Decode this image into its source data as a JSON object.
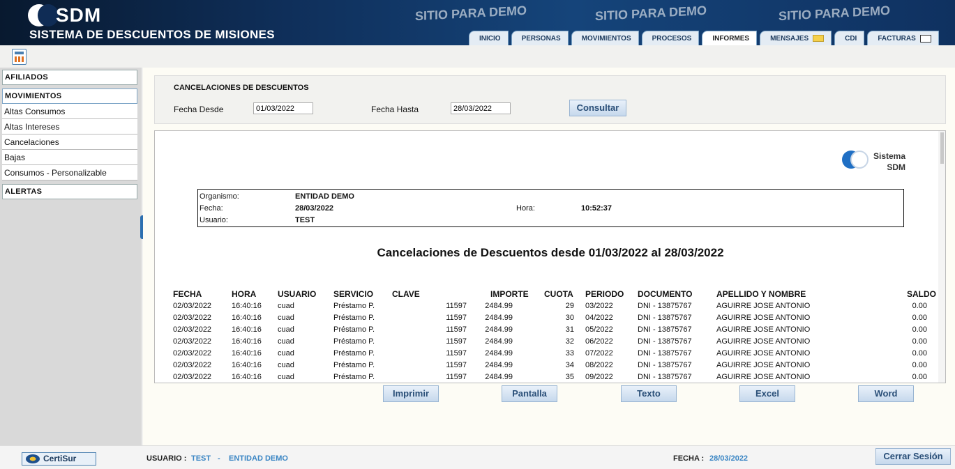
{
  "header": {
    "logo": "SDM",
    "subtitle": "SISTEMA DE DESCUENTOS DE MISIONES",
    "demo": "SITIO PARA DEMO"
  },
  "tabs": [
    "INICIO",
    "PERSONAS",
    "MOVIMIENTOS",
    "PROCESOS",
    "INFORMES",
    "MENSAJES",
    "CDI",
    "FACTURAS"
  ],
  "sidebar": {
    "afiliados": "AFILIADOS",
    "movimientos": "MOVIMIENTOS",
    "items": [
      "Altas Consumos",
      "Altas Intereses",
      "Cancelaciones",
      "Bajas",
      "Consumos - Personalizable"
    ],
    "alertas": "ALERTAS"
  },
  "filter": {
    "title": "CANCELACIONES DE DESCUENTOS",
    "desde_label": "Fecha Desde",
    "desde": "01/03/2022",
    "hasta_label": "Fecha Hasta",
    "hasta": "28/03/2022",
    "consultar": "Consultar"
  },
  "report": {
    "logo_line1": "Sistema",
    "logo_line2": "SDM",
    "organismo_label": "Organismo:",
    "organismo": "ENTIDAD DEMO",
    "fecha_label": "Fecha:",
    "fecha": "28/03/2022",
    "hora_label": "Hora:",
    "hora": "10:52:37",
    "usuario_label": "Usuario:",
    "usuario": "TEST",
    "title": "Cancelaciones de Descuentos desde 01/03/2022 al 28/03/2022",
    "columns": [
      "FECHA",
      "HORA",
      "USUARIO",
      "SERVICIO",
      "CLAVE",
      "IMPORTE",
      "CUOTA",
      "PERIODO",
      "DOCUMENTO",
      "APELLIDO Y NOMBRE",
      "SALDO"
    ],
    "rows": [
      [
        "02/03/2022",
        "16:40:16",
        "cuad",
        "Préstamo P.",
        "11597",
        "2484.99",
        "29",
        "03/2022",
        "DNI - 13875767",
        "AGUIRRE JOSE ANTONIO",
        "0.00"
      ],
      [
        "02/03/2022",
        "16:40:16",
        "cuad",
        "Préstamo P.",
        "11597",
        "2484.99",
        "30",
        "04/2022",
        "DNI - 13875767",
        "AGUIRRE JOSE ANTONIO",
        "0.00"
      ],
      [
        "02/03/2022",
        "16:40:16",
        "cuad",
        "Préstamo P.",
        "11597",
        "2484.99",
        "31",
        "05/2022",
        "DNI - 13875767",
        "AGUIRRE JOSE ANTONIO",
        "0.00"
      ],
      [
        "02/03/2022",
        "16:40:16",
        "cuad",
        "Préstamo P.",
        "11597",
        "2484.99",
        "32",
        "06/2022",
        "DNI - 13875767",
        "AGUIRRE JOSE ANTONIO",
        "0.00"
      ],
      [
        "02/03/2022",
        "16:40:16",
        "cuad",
        "Préstamo P.",
        "11597",
        "2484.99",
        "33",
        "07/2022",
        "DNI - 13875767",
        "AGUIRRE JOSE ANTONIO",
        "0.00"
      ],
      [
        "02/03/2022",
        "16:40:16",
        "cuad",
        "Préstamo P.",
        "11597",
        "2484.99",
        "34",
        "08/2022",
        "DNI - 13875767",
        "AGUIRRE JOSE ANTONIO",
        "0.00"
      ],
      [
        "02/03/2022",
        "16:40:16",
        "cuad",
        "Préstamo P.",
        "11597",
        "2484.99",
        "35",
        "09/2022",
        "DNI - 13875767",
        "AGUIRRE JOSE ANTONIO",
        "0.00"
      ]
    ]
  },
  "actions": [
    "Imprimir",
    "Pantalla",
    "Texto",
    "Excel",
    "Word"
  ],
  "footer": {
    "certisur": "CertiSur",
    "usuario_label": "USUARIO :",
    "usuario": "TEST",
    "sep": "-",
    "entidad": "ENTIDAD DEMO",
    "fecha_label": "FECHA :",
    "fecha": "28/03/2022",
    "cerrar": "Cerrar Sesión"
  }
}
